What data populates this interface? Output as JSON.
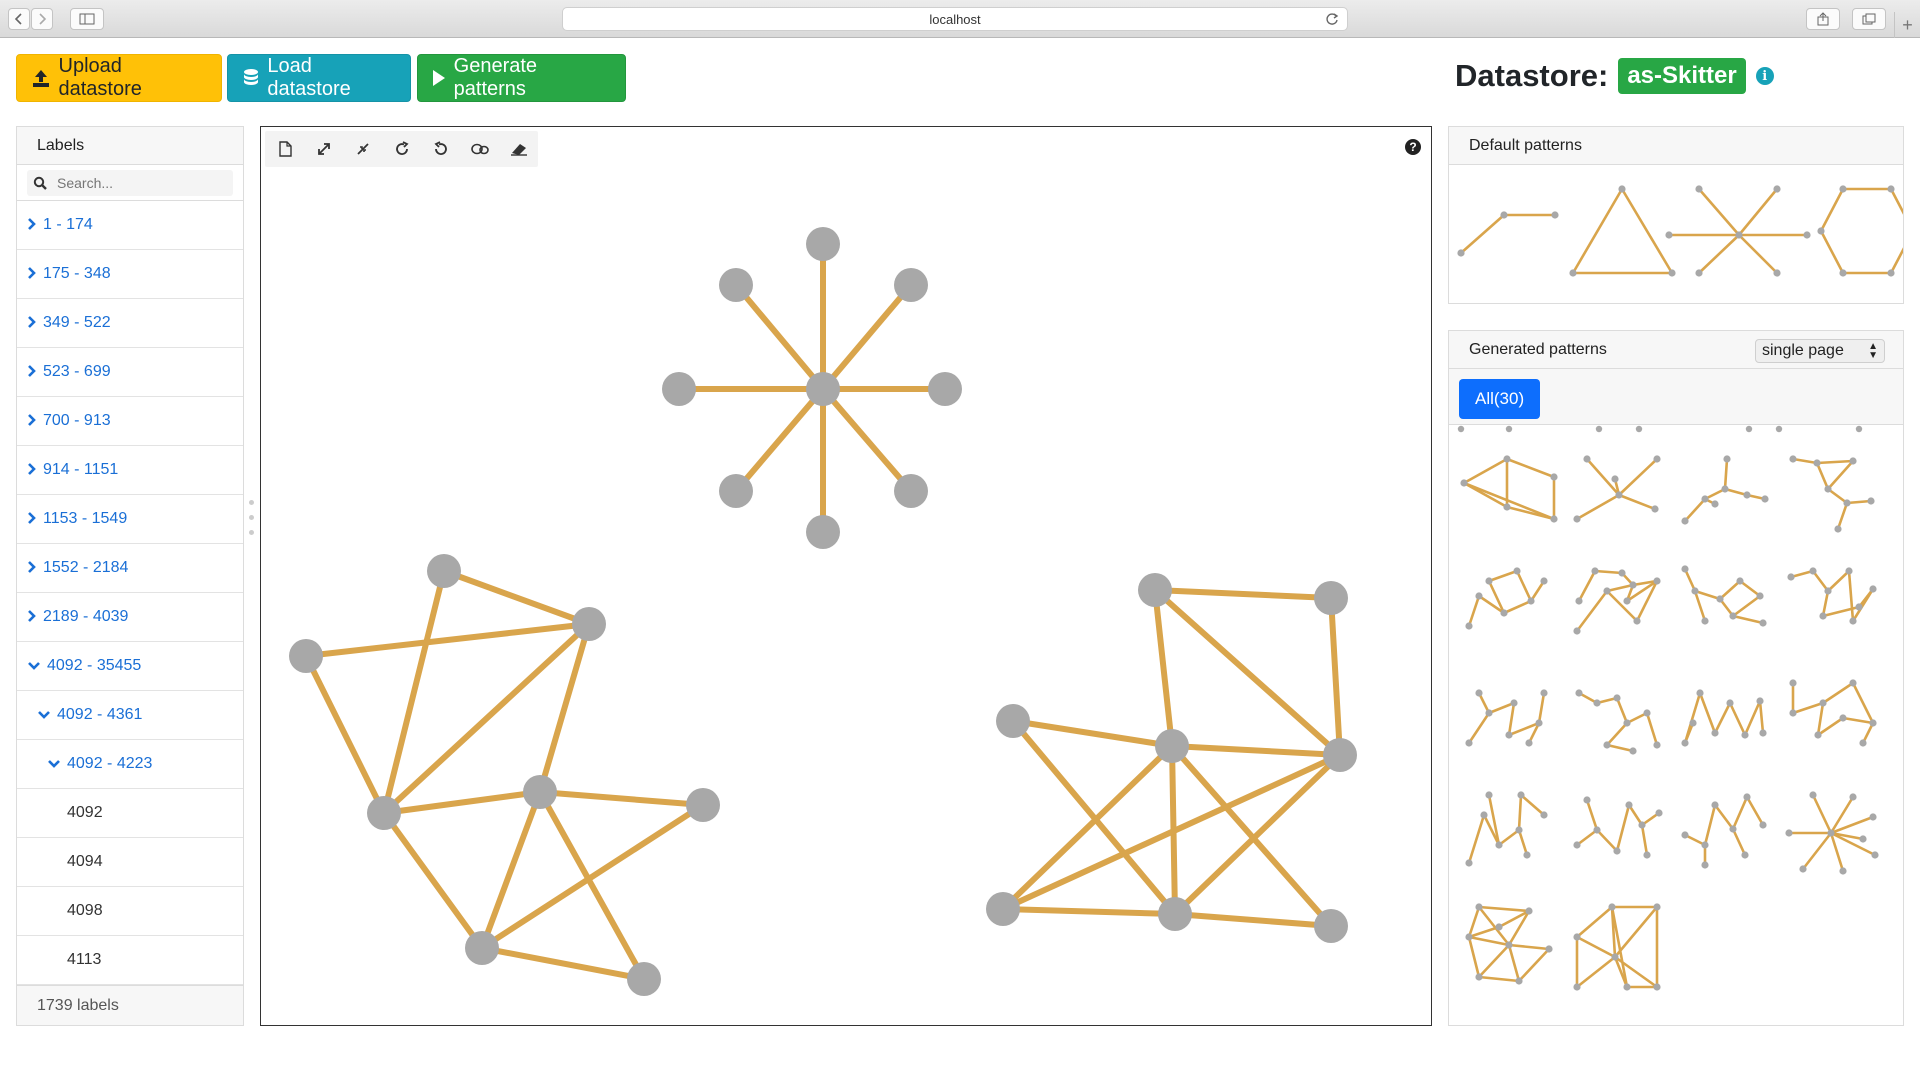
{
  "browser": {
    "url": "localhost"
  },
  "toolbar": {
    "upload_label": "Upload datastore",
    "load_label": "Load datastore",
    "generate_label": "Generate patterns"
  },
  "datastore": {
    "title": "Datastore:",
    "name": "as-Skitter",
    "info_icon": "i"
  },
  "labels_panel": {
    "header": "Labels",
    "search_placeholder": "Search...",
    "items": [
      {
        "label": "1 - 174",
        "state": "collapsed",
        "level": 0
      },
      {
        "label": "175 - 348",
        "state": "collapsed",
        "level": 0
      },
      {
        "label": "349 - 522",
        "state": "collapsed",
        "level": 0
      },
      {
        "label": "523 - 699",
        "state": "collapsed",
        "level": 0
      },
      {
        "label": "700 - 913",
        "state": "collapsed",
        "level": 0
      },
      {
        "label": "914 - 1151",
        "state": "collapsed",
        "level": 0
      },
      {
        "label": "1153 - 1549",
        "state": "collapsed",
        "level": 0
      },
      {
        "label": "1552 - 2184",
        "state": "collapsed",
        "level": 0
      },
      {
        "label": "2189 - 4039",
        "state": "collapsed",
        "level": 0
      },
      {
        "label": "4092 - 35455",
        "state": "expanded",
        "level": 0
      },
      {
        "label": "4092 - 4361",
        "state": "expanded",
        "level": 1
      },
      {
        "label": "4092 - 4223",
        "state": "expanded",
        "level": 2
      },
      {
        "label": "4092",
        "state": "leaf",
        "level": 3
      },
      {
        "label": "4094",
        "state": "leaf",
        "level": 3
      },
      {
        "label": "4098",
        "state": "leaf",
        "level": 3
      },
      {
        "label": "4113",
        "state": "leaf",
        "level": 3
      }
    ],
    "footer": "1739 labels"
  },
  "canvas": {
    "tools": [
      "new-file-icon",
      "expand-icon",
      "compress-icon",
      "redo-icon",
      "undo-icon",
      "lasso-icon",
      "eraser-icon"
    ],
    "help_icon": "?",
    "edge_color": "#d9a54c",
    "node_color": "#a8a8a8"
  },
  "default_patterns": {
    "header": "Default patterns",
    "items": [
      "path-pattern-icon",
      "triangle-pattern-icon",
      "star-pattern-icon",
      "hexagon-pattern-icon"
    ]
  },
  "generated_patterns": {
    "header": "Generated patterns",
    "select_value": "single page",
    "tab_label": "All(30)"
  },
  "colors": {
    "warning": "#ffc107",
    "info": "#17a2b8",
    "success": "#28a745",
    "primary": "#0d6efd",
    "link": "#1a6fd6"
  }
}
